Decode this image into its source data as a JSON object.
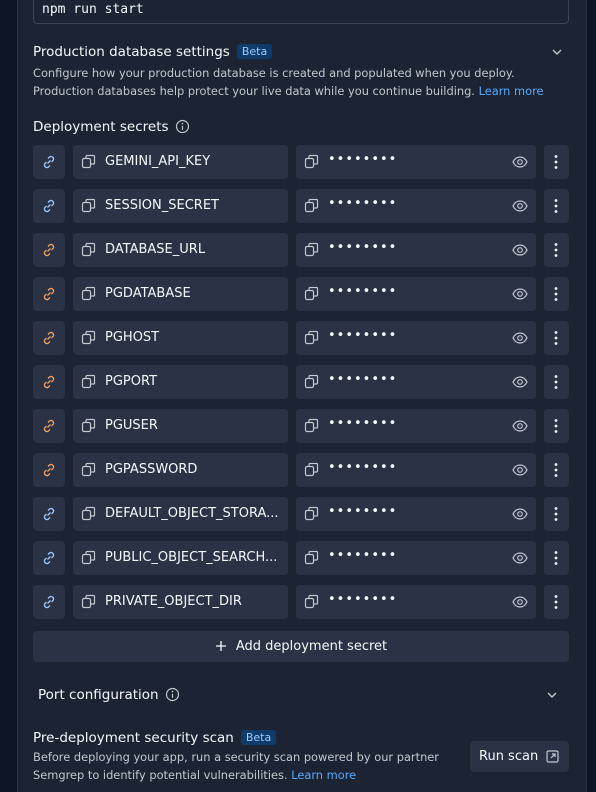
{
  "run_command": {
    "value": "npm run start"
  },
  "prod_db": {
    "title": "Production database settings",
    "badge": "Beta",
    "description": "Configure how your production database is created and populated when you deploy. Production databases help protect your live data while you continue building.",
    "learn_more": "Learn more",
    "icon": "chevron-down-icon"
  },
  "secrets": {
    "title": "Deployment secrets",
    "info_icon": "info-icon",
    "masked_value": "••••••••",
    "items": [
      {
        "key": "GEMINI_API_KEY",
        "link_color": "#9ccbff"
      },
      {
        "key": "SESSION_SECRET",
        "link_color": "#9ccbff"
      },
      {
        "key": "DATABASE_URL",
        "link_color": "#f0a35c"
      },
      {
        "key": "PGDATABASE",
        "link_color": "#f0a35c"
      },
      {
        "key": "PGHOST",
        "link_color": "#f0a35c"
      },
      {
        "key": "PGPORT",
        "link_color": "#f0a35c"
      },
      {
        "key": "PGUSER",
        "link_color": "#f0a35c"
      },
      {
        "key": "PGPASSWORD",
        "link_color": "#f0a35c"
      },
      {
        "key": "DEFAULT_OBJECT_STORA...",
        "link_color": "#9ccbff"
      },
      {
        "key": "PUBLIC_OBJECT_SEARCH...",
        "link_color": "#9ccbff"
      },
      {
        "key": "PRIVATE_OBJECT_DIR",
        "link_color": "#9ccbff"
      }
    ],
    "add_label": "Add deployment secret"
  },
  "port_config": {
    "title": "Port configuration"
  },
  "security_scan": {
    "title": "Pre-deployment security scan",
    "badge": "Beta",
    "description": "Before deploying your app, run a security scan powered by our partner Semgrep to identify potential vulnerabilities.",
    "learn_more": "Learn more",
    "run_label": "Run scan"
  }
}
